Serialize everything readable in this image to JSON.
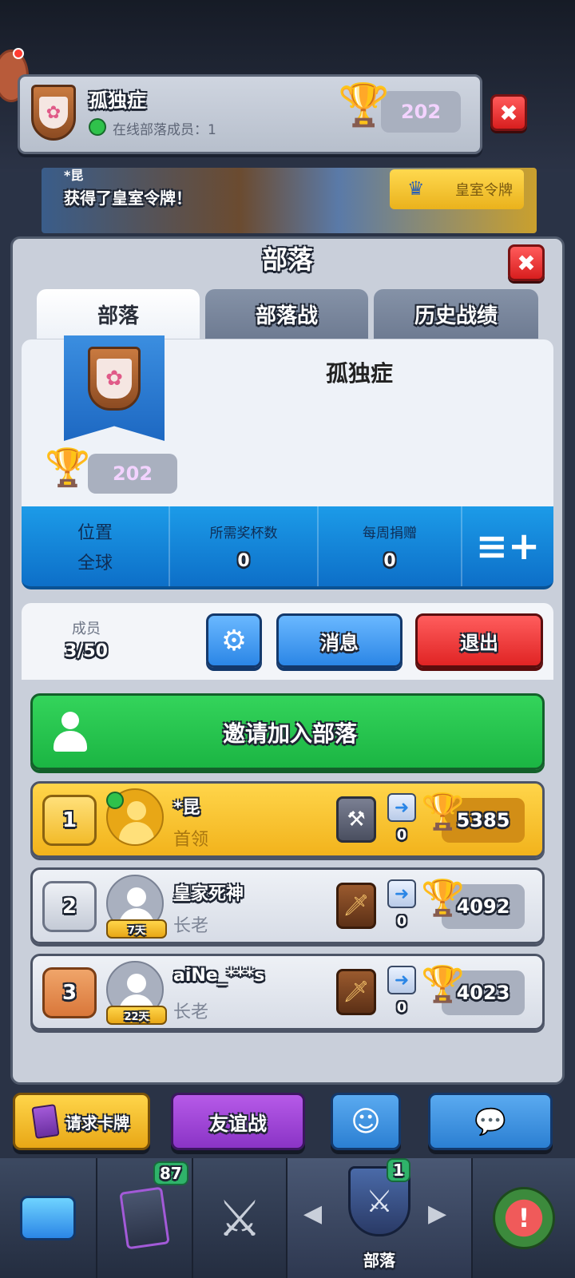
{
  "top_card": {
    "clan_name": "孤独症",
    "online_text": "在线部落成员：1",
    "trophies": "202",
    "close_label": "✖"
  },
  "banner": {
    "player_name": "*昆",
    "message": "获得了皇室令牌！",
    "token_label": "皇室令牌"
  },
  "panel": {
    "title": "部落",
    "close_label": "✖",
    "tabs": [
      {
        "label": "部落",
        "active": true
      },
      {
        "label": "部落战",
        "active": false
      },
      {
        "label": "历史战绩",
        "active": false
      }
    ]
  },
  "clan_info": {
    "name": "孤独症",
    "trophies": "202",
    "stats": [
      {
        "label": "位置",
        "value": "全球"
      },
      {
        "label": "所需奖杯数",
        "value": "0"
      },
      {
        "label": "每周捐赠",
        "value": "0"
      }
    ]
  },
  "members_bar": {
    "label": "成员",
    "count": "3/50",
    "settings_icon": "gear-icon",
    "message_label": "消息",
    "leave_label": "退出"
  },
  "invite": {
    "label": "邀请加入部落"
  },
  "members": [
    {
      "rank": "1",
      "name": "*昆",
      "role": "首领",
      "days": "",
      "online": true,
      "donations": "0",
      "trophies": "5385",
      "league_icon": "hammer-icon",
      "style": "gold"
    },
    {
      "rank": "2",
      "name": "皇家死神",
      "role": "长老",
      "days": "7天",
      "online": false,
      "donations": "0",
      "trophies": "4092",
      "league_icon": "sword-icon",
      "style": "silver"
    },
    {
      "rank": "3",
      "name": "aiNe_***s",
      "role": "长老",
      "days": "22天",
      "online": false,
      "donations": "0",
      "trophies": "4023",
      "league_icon": "sword-icon",
      "style": "bronze"
    }
  ],
  "bottom_actions": {
    "request_cards": "请求卡牌",
    "friendly_battle": "友谊战"
  },
  "nav": {
    "cards_badge": "87",
    "clan_badge": "1",
    "clan_label": "部落"
  },
  "colors": {
    "gold_row": "#f2b31c",
    "silver_row": "#d7dce6",
    "stats_blue": "#0d6fc8",
    "invite_green": "#1bb543",
    "leave_red": "#e02424"
  }
}
